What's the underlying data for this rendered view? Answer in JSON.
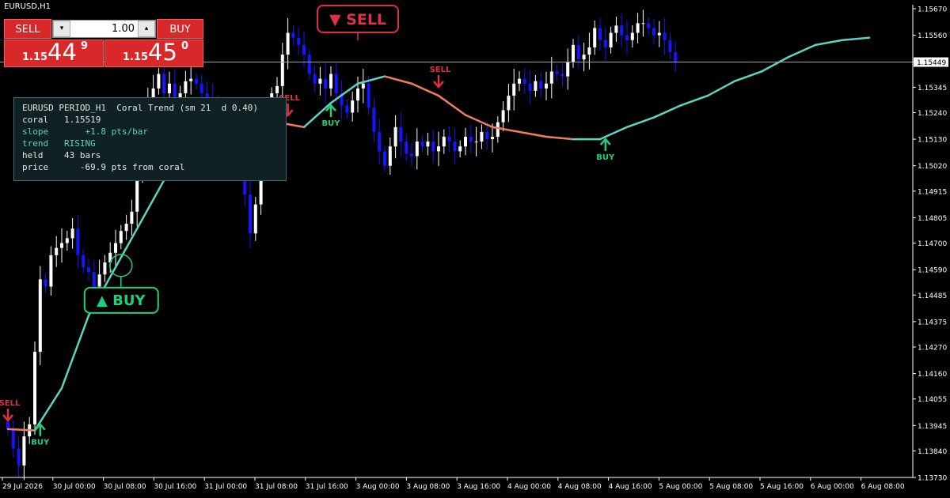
{
  "window": {
    "title": "EURUSD,H1"
  },
  "trade_panel": {
    "sell_label": "SELL",
    "buy_label": "BUY",
    "lot": "1.00",
    "minus_label": "▾",
    "plus_label": "▴",
    "bid": {
      "small": "1.15",
      "big": "44",
      "sup": "9"
    },
    "ask": {
      "small": "1.15",
      "big": "45",
      "sup": "0"
    }
  },
  "info_panel": {
    "header": "EURUSD PERIOD_H1  Coral Trend (sm 21  d 0.40)",
    "rows": [
      {
        "label": "coral",
        "value": "1.15519"
      },
      {
        "label": "slope",
        "value": "+1.8 pts/bar"
      },
      {
        "label": "trend",
        "value": "RISING"
      },
      {
        "label": "held",
        "value": "43 bars"
      },
      {
        "label": "price",
        "value": "-69.9 pts from coral"
      }
    ]
  },
  "colors": {
    "bull_candle": "#ffffff",
    "bear_candle": "#1515ff",
    "coral_rising": "#5fd3c2",
    "coral_falling": "#ef7d62",
    "buy_signal": "#1fd07a",
    "sell_signal": "#e03045",
    "price_line": "#9aa3a3"
  },
  "chart_data": {
    "type": "candlestick",
    "symbol": "EURUSD",
    "timeframe": "H1",
    "ylim": [
      1.1374,
      1.157
    ],
    "current_price": "1.15449",
    "y_ticks": [
      "1.15670",
      "1.15560",
      "1.15450",
      "1.15345",
      "1.15240",
      "1.15130",
      "1.15020",
      "1.14915",
      "1.14805",
      "1.14700",
      "1.14590",
      "1.14485",
      "1.14375",
      "1.14270",
      "1.14160",
      "1.14055",
      "1.13945",
      "1.13840",
      "1.13730"
    ],
    "x_ticks": [
      "29 Jul 2026",
      "30 Jul 00:00",
      "30 Jul 08:00",
      "30 Jul 16:00",
      "31 Jul 00:00",
      "31 Jul 08:00",
      "31 Jul 16:00",
      "3 Aug 00:00",
      "3 Aug 08:00",
      "3 Aug 16:00",
      "4 Aug 00:00",
      "4 Aug 08:00",
      "4 Aug 16:00",
      "5 Aug 00:00",
      "5 Aug 08:00",
      "5 Aug 16:00",
      "6 Aug 00:00",
      "6 Aug 08:00"
    ],
    "closes": [
      1.1393,
      1.1385,
      1.1378,
      1.139,
      1.1395,
      1.1425,
      1.1455,
      1.1452,
      1.1465,
      1.1468,
      1.147,
      1.1472,
      1.1476,
      1.1465,
      1.146,
      1.1458,
      1.1452,
      1.1457,
      1.1462,
      1.1466,
      1.147,
      1.1475,
      1.1478,
      1.1483,
      1.1498,
      1.1516,
      1.153,
      1.1534,
      1.154,
      1.1532,
      1.1536,
      1.1528,
      1.1532,
      1.1537,
      1.1538,
      1.1536,
      1.1532,
      1.153,
      1.1528,
      1.1526,
      1.1522,
      1.1518,
      1.151,
      1.1502,
      1.149,
      1.1474,
      1.1486,
      1.1502,
      1.1518,
      1.1532,
      1.1535,
      1.1548,
      1.1557,
      1.1555,
      1.1552,
      1.1548,
      1.154,
      1.1536,
      1.1538,
      1.1534,
      1.154,
      1.1532,
      1.1527,
      1.1524,
      1.1529,
      1.1534,
      1.1536,
      1.1526,
      1.1516,
      1.1508,
      1.1502,
      1.151,
      1.1518,
      1.1512,
      1.1507,
      1.1506,
      1.1512,
      1.151,
      1.1512,
      1.1508,
      1.151,
      1.1514,
      1.1512,
      1.1508,
      1.151,
      1.1514,
      1.1512,
      1.1512,
      1.1516,
      1.1513,
      1.1514,
      1.152,
      1.1525,
      1.1531,
      1.1536,
      1.1538,
      1.1536,
      1.1533,
      1.1537,
      1.1534,
      1.1536,
      1.1541,
      1.154,
      1.1539,
      1.1545,
      1.1552,
      1.1546,
      1.1548,
      1.1551,
      1.1559,
      1.1554,
      1.1551,
      1.1557,
      1.156,
      1.1556,
      1.1554,
      1.1557,
      1.1561,
      1.1561,
      1.1559,
      1.1556,
      1.1557,
      1.1554,
      1.1549,
      1.1545
    ],
    "coral": [
      [
        0,
        1.1393
      ],
      [
        5,
        1.13925
      ],
      [
        10,
        1.141
      ],
      [
        15,
        1.144
      ],
      [
        20,
        1.146
      ],
      [
        25,
        1.148
      ],
      [
        30,
        1.15
      ],
      [
        35,
        1.1518
      ],
      [
        40,
        1.1527
      ],
      [
        45,
        1.1527
      ],
      [
        50,
        1.152
      ],
      [
        55,
        1.1518
      ],
      [
        60,
        1.1528
      ],
      [
        65,
        1.1536
      ],
      [
        70,
        1.1539
      ],
      [
        75,
        1.1536
      ],
      [
        80,
        1.1531
      ],
      [
        85,
        1.1523
      ],
      [
        90,
        1.1518
      ],
      [
        95,
        1.1516
      ],
      [
        100,
        1.1514
      ],
      [
        105,
        1.1513
      ],
      [
        110,
        1.1513
      ],
      [
        115,
        1.1518
      ],
      [
        120,
        1.1522
      ],
      [
        125,
        1.1527
      ],
      [
        130,
        1.1531
      ],
      [
        135,
        1.1537
      ],
      [
        140,
        1.1541
      ],
      [
        145,
        1.1547
      ],
      [
        150,
        1.1552
      ],
      [
        155,
        1.1554
      ],
      [
        160,
        1.1555
      ]
    ],
    "signals": [
      {
        "type": "sell",
        "label": "SELL",
        "bar": 0
      },
      {
        "type": "buy",
        "label": "BUY",
        "bar": 6
      },
      {
        "type": "sell",
        "label": "SELL",
        "bar": 52
      },
      {
        "type": "buy",
        "label": "BUY",
        "bar": 60
      },
      {
        "type": "sell",
        "label": "SELL",
        "bar": 80
      },
      {
        "type": "buy",
        "label": "BUY",
        "bar": 111
      }
    ],
    "callouts": [
      {
        "type": "buy",
        "label": "▲ BUY",
        "bar": 21
      },
      {
        "type": "sell",
        "label": "▼ SELL",
        "bar": 65
      }
    ]
  }
}
